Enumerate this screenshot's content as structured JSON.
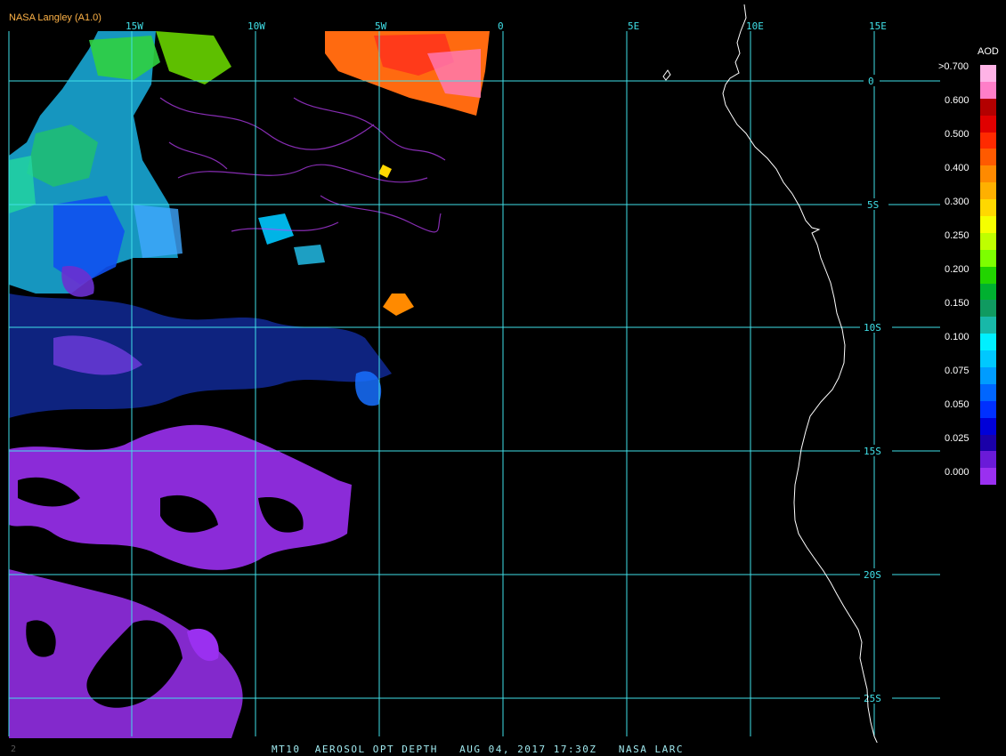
{
  "header": {
    "brand": "NASA Langley (A1.0)"
  },
  "footer": {
    "caption": "MT10  AEROSOL OPT DEPTH   AUG 04, 2017 17:30Z   NASA LARC",
    "corner_mark": "2"
  },
  "map": {
    "longitude_labels": [
      "15W",
      "10W",
      "5W",
      "0",
      "5E",
      "10E",
      "15E"
    ],
    "latitude_labels": [
      "0",
      "5S",
      "10S",
      "15S",
      "20S",
      "25S"
    ],
    "colors": {
      "grid": "#40e0e8",
      "coastline": "#ffffff",
      "background": "#000000"
    }
  },
  "legend": {
    "title": "AOD",
    "labels": [
      ">0.700",
      "0.600",
      "0.500",
      "0.400",
      "0.300",
      "0.250",
      "0.200",
      "0.150",
      "0.100",
      "0.075",
      "0.050",
      "0.025",
      "0.000"
    ],
    "colors": [
      "#ffb3e6",
      "#ff7ec8",
      "#b30000",
      "#e00000",
      "#ff2a00",
      "#ff5a00",
      "#ff8a00",
      "#ffb000",
      "#ffd800",
      "#f5ff00",
      "#bfff00",
      "#7dff00",
      "#22d400",
      "#00b030",
      "#109a60",
      "#18b8a8",
      "#00f0ff",
      "#00c8ff",
      "#009cff",
      "#0066ff",
      "#0030ff",
      "#0000d8",
      "#1a00a8",
      "#6a1ad8",
      "#9a30f0"
    ]
  }
}
